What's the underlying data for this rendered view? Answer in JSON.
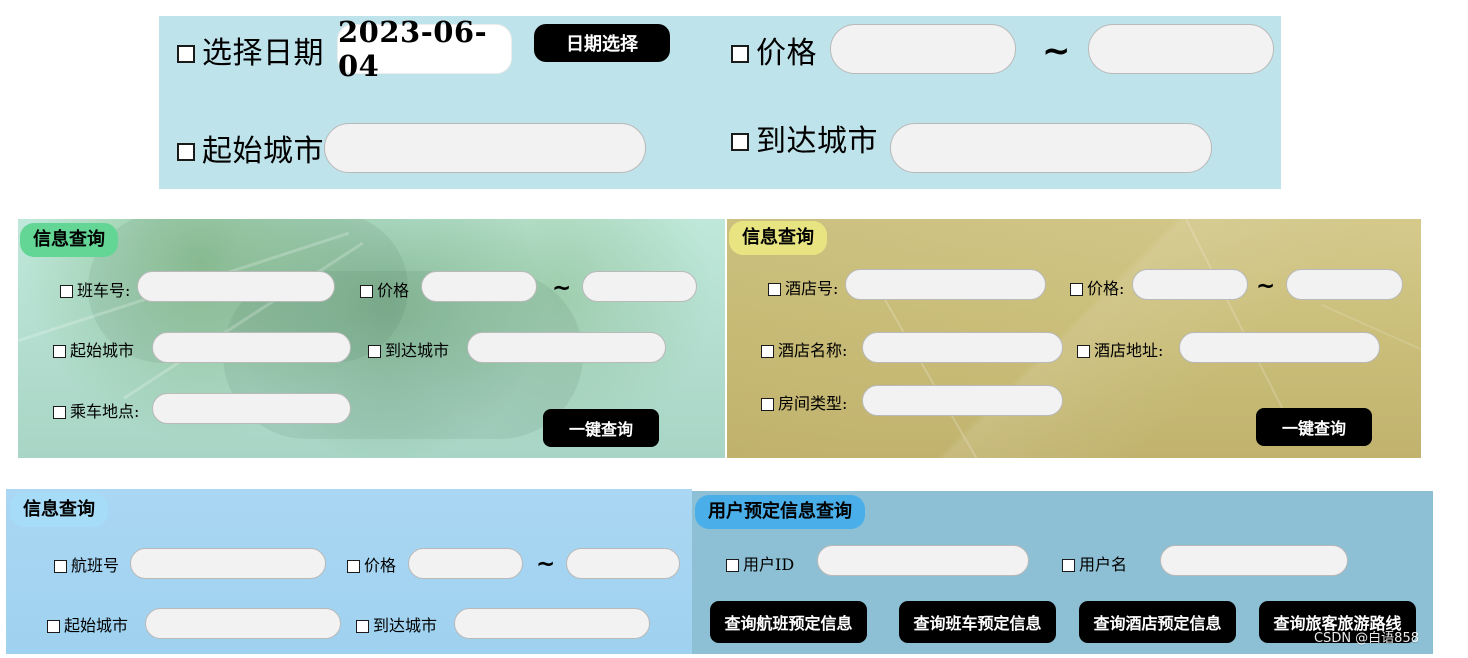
{
  "top_filter": {
    "select_date_label": "选择日期",
    "date_value": "2023-06-04",
    "date_pick_button": "日期选择",
    "price_label": "价格",
    "price_range_separator": "~",
    "departure_city_label": "起始城市",
    "arrival_city_label": "到达城市"
  },
  "bus_query": {
    "title": "信息查询",
    "bus_number_label": "班车号:",
    "price_label": "价格",
    "price_range_separator": "~",
    "departure_city_label": "起始城市",
    "arrival_city_label": "到达城市",
    "boarding_place_label": "乘车地点:",
    "query_button": "一键查询"
  },
  "hotel_query": {
    "title": "信息查询",
    "hotel_number_label": "酒店号:",
    "price_label": "价格:",
    "price_range_separator": "~",
    "hotel_name_label": "酒店名称:",
    "hotel_address_label": "酒店地址:",
    "room_type_label": "房间类型:",
    "query_button": "一键查询"
  },
  "flight_query": {
    "title": "信息查询",
    "flight_number_label": "航班号",
    "price_label": "价格",
    "price_range_separator": "~",
    "departure_city_label": "起始城市",
    "arrival_city_label": "到达城市"
  },
  "user_booking_query": {
    "title": "用户预定信息查询",
    "user_id_label": "用户ID",
    "username_label": "用户名",
    "flight_booking_button": "查询航班预定信息",
    "bus_booking_button": "查询班车预定信息",
    "hotel_booking_button": "查询酒店预定信息",
    "tour_route_button": "查询旅客旅游路线"
  },
  "watermark": "CSDN @白语858",
  "colors": {
    "top_panel": "#bfe3ea",
    "bus_title": "#63d595",
    "hotel_title": "#e8e482",
    "flight_panel": "#a6dcf7",
    "user_title": "#4aaee9",
    "button": "#000000",
    "input": "#f2f2f2"
  }
}
